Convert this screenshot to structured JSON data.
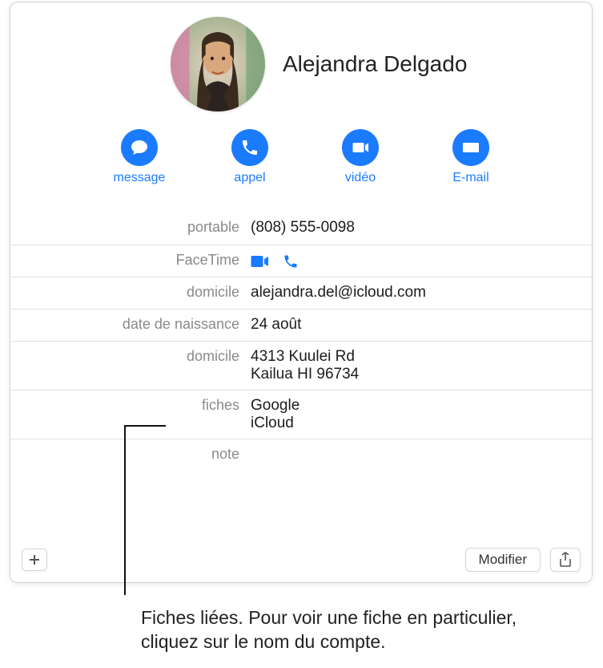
{
  "contact": {
    "name": "Alejandra Delgado"
  },
  "actions": {
    "message": "message",
    "call": "appel",
    "video": "vidéo",
    "email": "E-mail"
  },
  "labels": {
    "mobile": "portable",
    "facetime": "FaceTime",
    "home_email": "domicile",
    "birthday": "date de naissance",
    "home_addr": "domicile",
    "cards": "fiches",
    "note": "note"
  },
  "values": {
    "mobile": "(808) 555-0098",
    "home_email": "alejandra.del@icloud.com",
    "birthday": "24 août",
    "addr_line1": "4313 Kuulei Rd",
    "addr_line2": "Kailua HI 96734",
    "note": ""
  },
  "cards": {
    "google": "Google",
    "icloud": "iCloud"
  },
  "buttons": {
    "modify": "Modifier"
  },
  "caption": "Fiches liées. Pour voir une fiche en particulier, cliquez sur le nom du compte."
}
